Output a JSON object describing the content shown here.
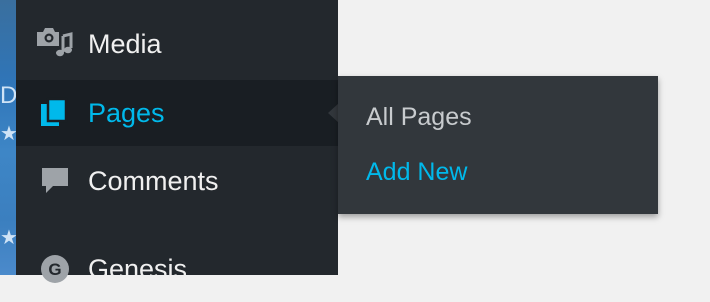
{
  "background_glyphs": [
    "Di",
    "★",
    "★"
  ],
  "menu": {
    "items": [
      {
        "label": "Media",
        "icon": "media-icon"
      },
      {
        "label": "Pages",
        "icon": "pages-icon",
        "current": true
      },
      {
        "label": "Comments",
        "icon": "comments-icon"
      },
      {
        "label": "Genesis",
        "icon": "genesis-icon",
        "icon_letter": "G"
      }
    ]
  },
  "flyout": {
    "items": [
      {
        "label": "All Pages"
      },
      {
        "label": "Add New",
        "current": true
      }
    ]
  },
  "colors": {
    "sidebar": "#23282d",
    "sidebar_current": "#191e23",
    "flyout": "#32373c",
    "accent": "#00b9eb",
    "text": "#f0f0f0",
    "icon": "#9ea3a8"
  }
}
